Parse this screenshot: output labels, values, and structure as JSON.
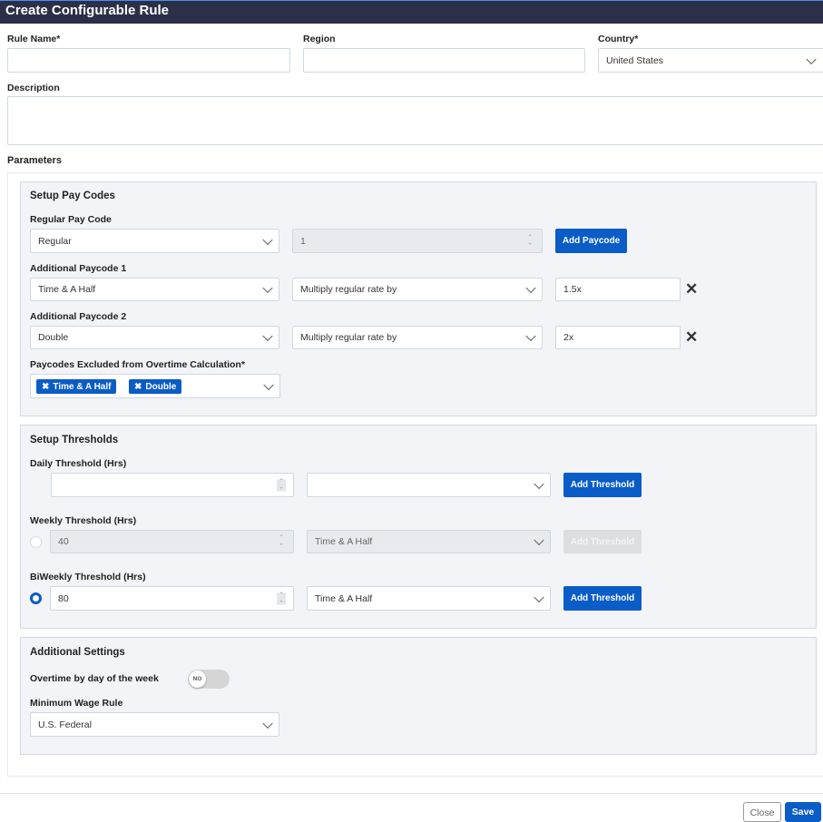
{
  "header": {
    "title": "Create Configurable Rule"
  },
  "form": {
    "rule_name": {
      "label": "Rule Name*",
      "value": ""
    },
    "region": {
      "label": "Region",
      "value": ""
    },
    "country": {
      "label": "Country*",
      "value": "United States"
    },
    "description": {
      "label": "Description",
      "value": ""
    },
    "parameters_label": "Parameters"
  },
  "pay_codes": {
    "title": "Setup Pay Codes",
    "regular": {
      "label": "Regular Pay Code",
      "value": "Regular",
      "number": "1",
      "button": "Add Paycode"
    },
    "additional": [
      {
        "label": "Additional Paycode 1",
        "value": "Time & A Half",
        "rule": "Multiply regular rate by",
        "rate": "1.5x"
      },
      {
        "label": "Additional Paycode 2",
        "value": "Double",
        "rule": "Multiply regular rate by",
        "rate": "2x"
      }
    ],
    "excluded": {
      "label": "Paycodes Excluded from Overtime Calculation*",
      "tags": [
        "Time & A Half",
        "Double"
      ]
    }
  },
  "thresholds": {
    "title": "Setup Thresholds",
    "rows": [
      {
        "label": "Daily Threshold (Hrs)",
        "value": "",
        "paycode": "",
        "button": "Add Threshold"
      },
      {
        "label": "Weekly Threshold (Hrs)",
        "value": "40",
        "paycode": "Time & A Half",
        "button": "Add Threshold"
      },
      {
        "label": "BiWeekly Threshold (Hrs)",
        "value": "80",
        "paycode": "Time & A Half",
        "button": "Add Threshold"
      }
    ]
  },
  "additional": {
    "title": "Additional Settings",
    "overtime_label": "Overtime by day of the week",
    "toggle": "NO",
    "min_wage_label": "Minimum Wage Rule",
    "min_wage_value": "U.S. Federal"
  },
  "footer": {
    "close": "Close",
    "save": "Save"
  }
}
